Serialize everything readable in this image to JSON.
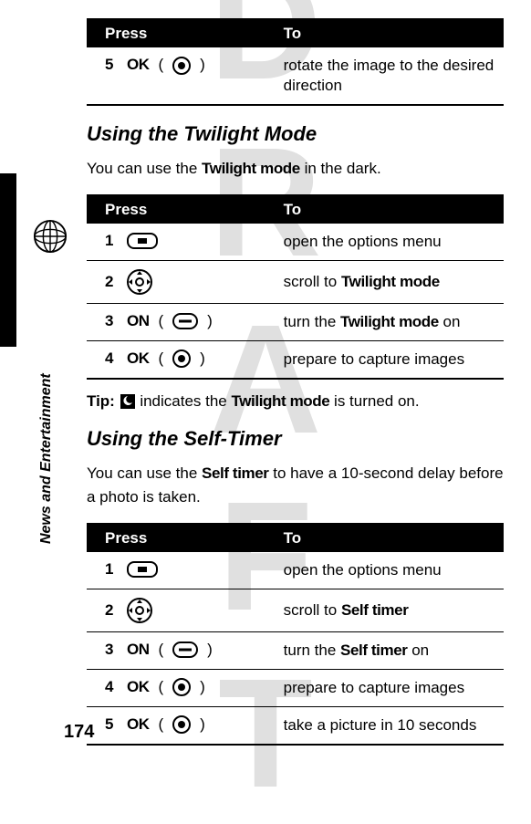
{
  "watermark": "DRAFT",
  "side_label": "News and Entertainment",
  "page_number": "174",
  "table_headers": {
    "press": "Press",
    "to": "To"
  },
  "table1": {
    "rows": [
      {
        "step": "5",
        "key": "OK",
        "paren_open": "(",
        "paren_close": ")",
        "to": "rotate the image to the desired direction"
      }
    ]
  },
  "section1": {
    "heading": "Using the Twilight Mode",
    "intro_pre": "You can use the ",
    "intro_bold": "Twilight mode",
    "intro_post": " in the dark.",
    "rows": [
      {
        "step": "1",
        "to": "open the options menu"
      },
      {
        "step": "2",
        "to_pre": "scroll to ",
        "to_bold": "Twilight mode"
      },
      {
        "step": "3",
        "key": "ON",
        "paren_open": "(",
        "paren_close": ")",
        "to_pre": "turn the ",
        "to_bold": "Twilight mode",
        "to_post": " on"
      },
      {
        "step": "4",
        "key": "OK",
        "paren_open": "(",
        "paren_close": ")",
        "to": "prepare to capture images"
      }
    ]
  },
  "tip": {
    "label": "Tip:  ",
    "pre": " indicates the ",
    "bold": "Twilight mode",
    "post": " is turned on."
  },
  "section2": {
    "heading": "Using the Self-Timer",
    "intro_pre": "You can use the ",
    "intro_bold": "Self timer",
    "intro_post": " to have a 10-second delay before a photo is taken.",
    "rows": [
      {
        "step": "1",
        "to": "open the options menu"
      },
      {
        "step": "2",
        "to_pre": "scroll to ",
        "to_bold": "Self timer"
      },
      {
        "step": "3",
        "key": "ON",
        "paren_open": "(",
        "paren_close": ")",
        "to_pre": "turn the ",
        "to_bold": "Self timer",
        "to_post": " on"
      },
      {
        "step": "4",
        "key": "OK",
        "paren_open": "(",
        "paren_close": ")",
        "to": "prepare to capture images"
      },
      {
        "step": "5",
        "key": "OK",
        "paren_open": "(",
        "paren_close": ")",
        "to": "take a picture in 10 seconds"
      }
    ]
  }
}
